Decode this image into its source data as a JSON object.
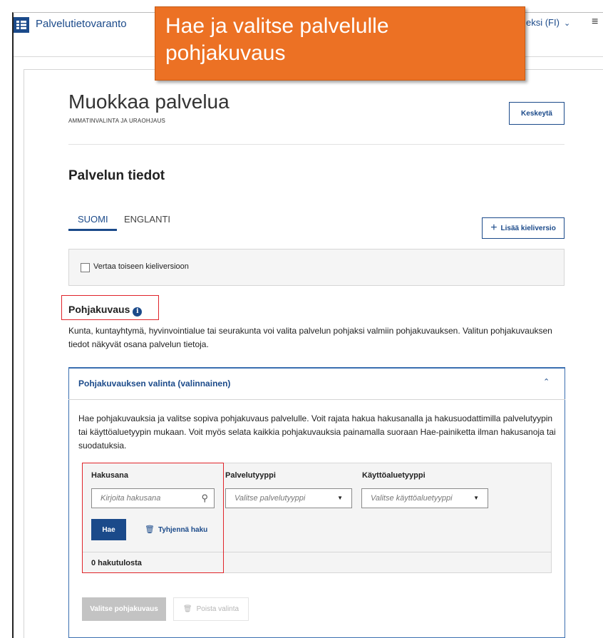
{
  "header": {
    "app_name": "Palvelutietovaranto",
    "language_selector": "eksi (FI)",
    "language_chevron": "chevron-down-icon",
    "menu_icon": "hamburger-icon"
  },
  "banner": {
    "text": "Hae ja valitse palvelulle pohjakuvaus"
  },
  "page": {
    "title": "Muokkaa palvelua",
    "subtitle": "AMMATINVALINTA JA URAOHJAUS",
    "cancel_label": "Keskeytä"
  },
  "service_info": {
    "title": "Palvelun tiedot",
    "tabs": [
      {
        "label": "SUOMI",
        "active": true
      },
      {
        "label": "ENGLANTI",
        "active": false
      }
    ],
    "add_language_label": "Lisää kieliversio",
    "compare_label": "Vertaa toiseen kieliversioon"
  },
  "base_description": {
    "title": "Pohjakuvaus",
    "description": "Kunta, kuntayhtymä, hyvinvointialue tai seurakunta voi valita palvelun pohjaksi valmiin pohjakuvauksen. Valitun pohjakuvauksen tiedot näkyvät osana palvelun tietoja."
  },
  "accordion": {
    "title": "Pohjakuvauksen valinta (valinnainen)",
    "expanded": true,
    "body_text": "Hae pohjakuvauksia ja valitse sopiva pohjakuvaus palvelulle. Voit rajata hakua hakusanalla ja hakusuodattimilla palvelutyypin tai käyttöaluetyypin mukaan. Voit myös selata kaikkia pohjakuvauksia painamalla suoraan Hae-painiketta ilman hakusanoja tai suodatuksia."
  },
  "search": {
    "keyword_label": "Hakusana",
    "keyword_placeholder": "Kirjoita hakusana",
    "service_type_label": "Palvelutyyppi",
    "service_type_placeholder": "Valitse palvelutyyppi",
    "usage_area_label": "Käyttöaluetyyppi",
    "usage_area_placeholder": "Valitse käyttöaluetyyppi",
    "search_button": "Hae",
    "clear_button": "Tyhjennä haku",
    "results_count": "0 hakutulosta"
  },
  "actions": {
    "select_button": "Valitse pohjakuvaus",
    "remove_button": "Poista valinta"
  },
  "colors": {
    "brand_blue": "#1b4a8a",
    "banner_orange": "#ec7124",
    "highlight_red": "#e0242a",
    "disabled_gray": "#c3c3c3"
  }
}
